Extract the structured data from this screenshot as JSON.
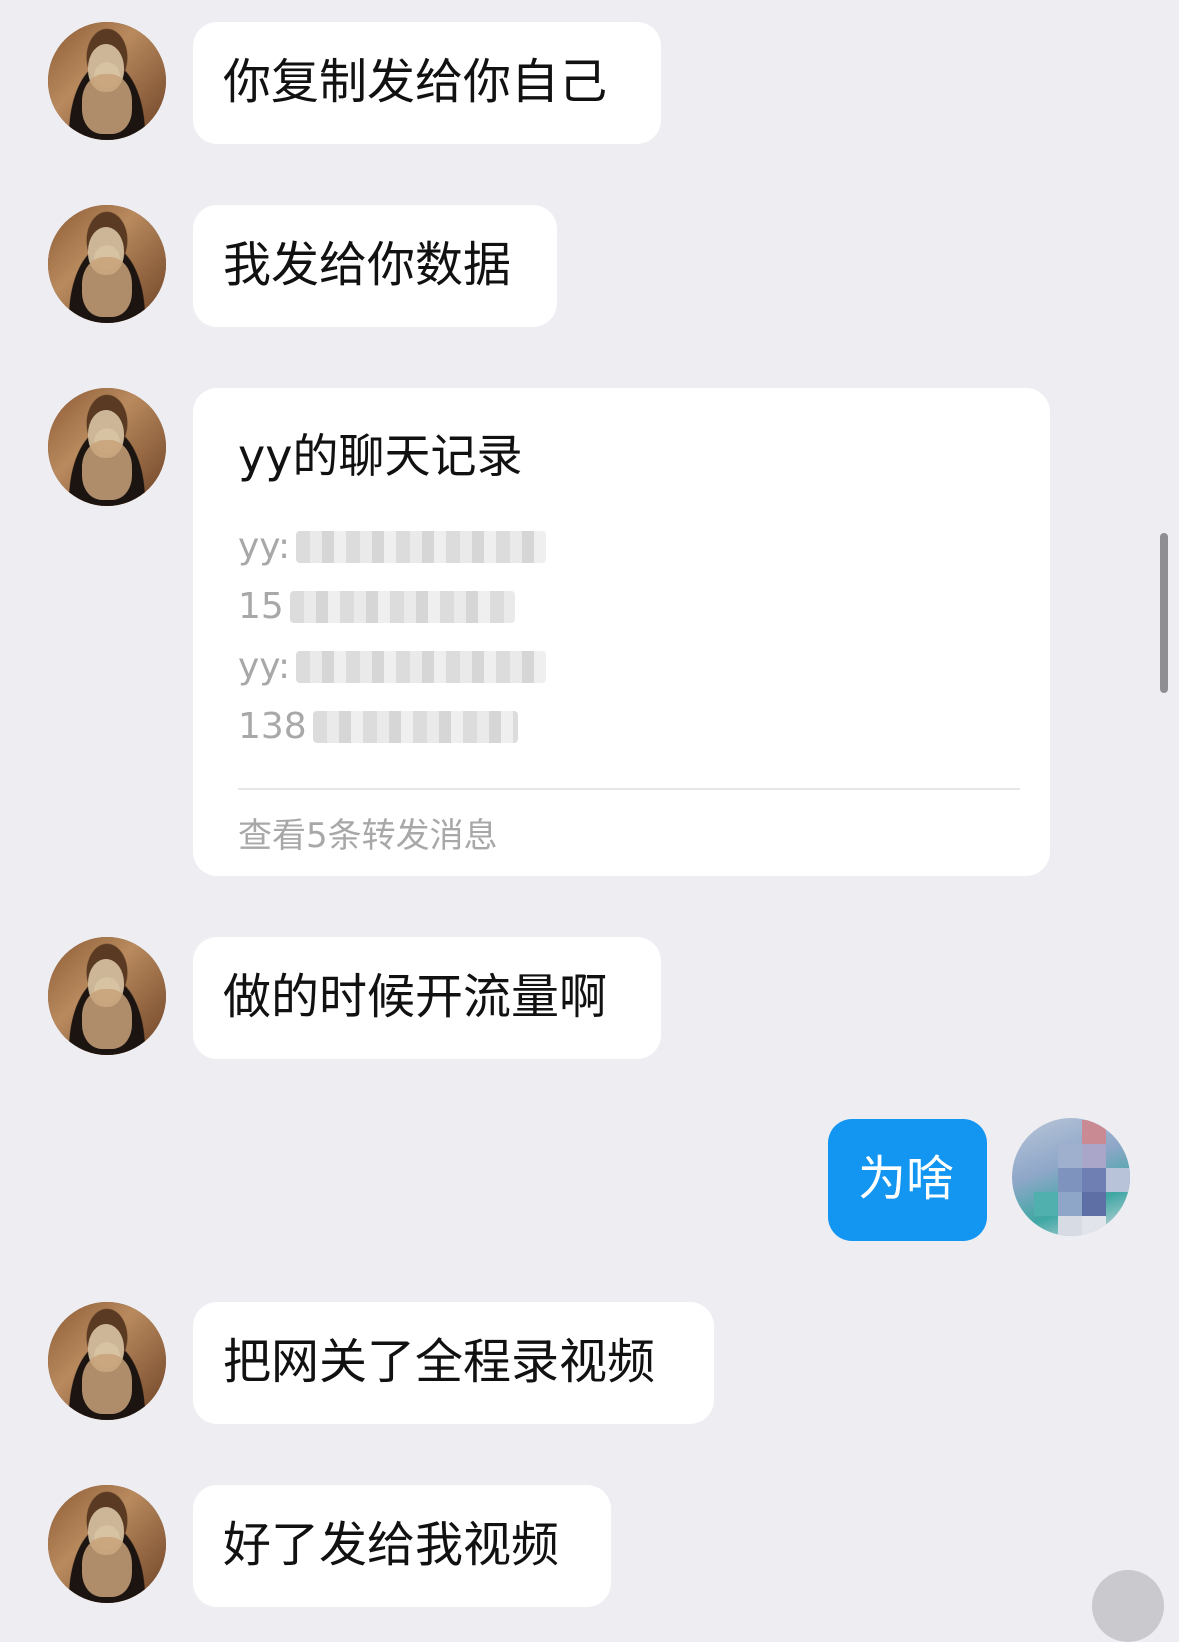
{
  "messages": [
    {
      "sender": "other",
      "text": "你复制发给你自己"
    },
    {
      "sender": "other",
      "text": "我发给你数据"
    },
    {
      "sender": "other",
      "forward_card": {
        "title": "yy的聊天记录",
        "lines": [
          "yy:",
          "15",
          "yy:",
          "138"
        ],
        "footer": "查看5条转发消息"
      }
    },
    {
      "sender": "other",
      "text": "做的时候开流量啊"
    },
    {
      "sender": "me",
      "text": "为啥"
    },
    {
      "sender": "other",
      "text": "把网关了全程录视频"
    },
    {
      "sender": "other",
      "text": "好了发给我视频"
    }
  ],
  "colors": {
    "background": "#ededf2",
    "bubble_other": "#ffffff",
    "bubble_me": "#1296f2",
    "muted_text": "#a8a8a8"
  },
  "icons": [
    "contact-avatar",
    "self-avatar-pixelated",
    "scroll-indicator"
  ]
}
